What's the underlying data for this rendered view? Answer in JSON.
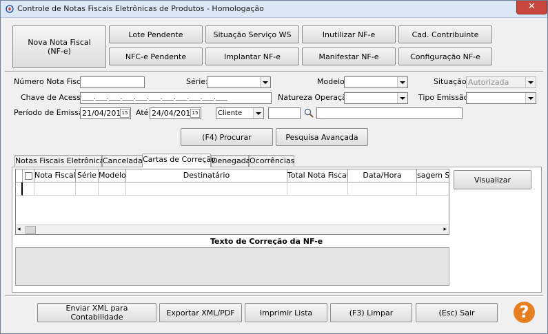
{
  "window": {
    "title": "Controle de Notas Fiscais Eletrônicas de Produtos - Homologação",
    "close": "✕"
  },
  "toolbar": {
    "nova_nota": "Nova Nota Fiscal\n(NF-e)",
    "lote_pendente": "Lote Pendente",
    "situacao_servico": "Situação Serviço WS",
    "inutilizar": "Inutilizar NF-e",
    "cad_contribuinte": "Cad. Contribuinte",
    "nfce_pendente": "NFC-e Pendente",
    "implantar": "Implantar NF-e",
    "manifestar": "Manifestar NF-e",
    "configuracao": "Configuração NF-e"
  },
  "filters": {
    "numero_label": "Número Nota Fiscal:",
    "numero_value": "",
    "serie_label": "Série:",
    "serie_value": "",
    "modelo_label": "Modelo:",
    "modelo_value": "",
    "situacao_label": "Situação:",
    "situacao_value": "Autorizada",
    "chave_label": "Chave de Acesso:",
    "chave_value": "____.____.____.____.____.____.____.____.____.____.____",
    "natureza_label": "Natureza Operação:",
    "natureza_value": "",
    "tipo_emissao_label": "Tipo Emissão:",
    "tipo_emissao_value": "",
    "periodo_label": "Período de Emissão:",
    "data_inicio": "21/04/2018",
    "ate_label": "Até",
    "data_fim": "24/04/2018",
    "calendar_glyph": "15",
    "tipo_pessoa": "Cliente",
    "codigo_value": "",
    "nome_value": ""
  },
  "search": {
    "procurar": "(F4) Procurar",
    "avancada": "Pesquisa Avançada"
  },
  "tabs": [
    {
      "label": "Notas Fiscais Eletrônicas"
    },
    {
      "label": "Cancelada"
    },
    {
      "label": "Cartas de Correção"
    },
    {
      "label": "Denegada"
    },
    {
      "label": "Ocorrências"
    }
  ],
  "grid": {
    "columns": [
      "Nota Fiscal",
      "Série",
      "Modelo",
      "Destinatário",
      "Total Nota Fiscal",
      "Data/Hora",
      "sagem SE"
    ],
    "scroll_left": "◂",
    "scroll_right": "▸"
  },
  "visualizar": "Visualizar",
  "correction_text_label": "Texto de Correção da NF-e",
  "footer": {
    "enviar_xml": "Enviar XML para Contabilidade",
    "exportar": "Exportar XML/PDF",
    "imprimir": "Imprimir Lista",
    "limpar": "(F3) Limpar",
    "sair": "(Esc) Sair"
  },
  "help_icon_glyph": "?",
  "colors": {
    "help_orange": "#e67e22",
    "close_red": "#c7473e",
    "titlebar": "#dbe7f4"
  }
}
